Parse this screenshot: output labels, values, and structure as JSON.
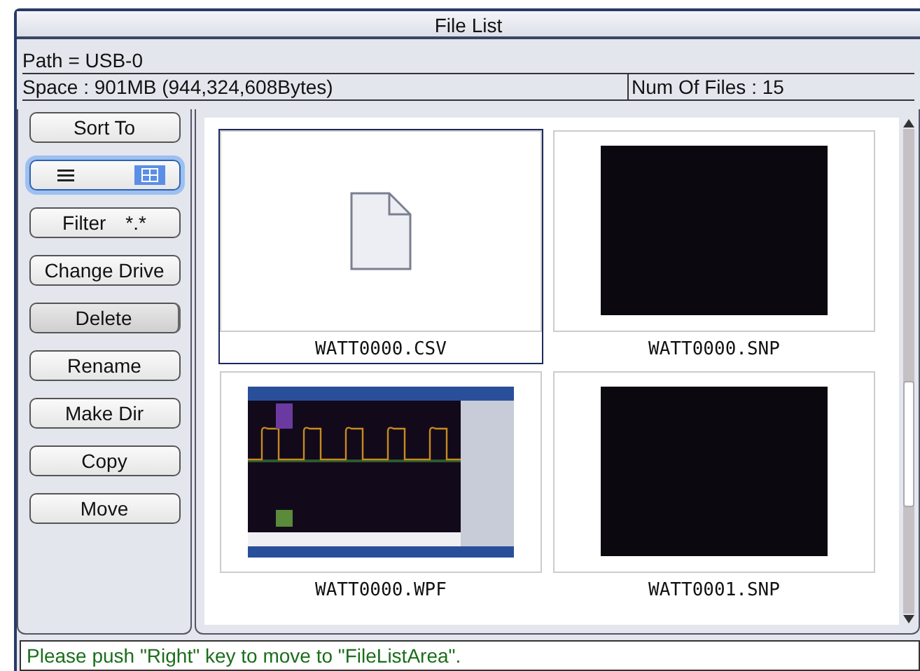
{
  "window": {
    "title": "File List"
  },
  "path": "Path = USB-0",
  "space": "Space : 901MB (944,324,608Bytes)",
  "num_files": "Num Of Files : 15",
  "sidebar": [
    {
      "kind": "button",
      "label": "Sort To",
      "pressed": false
    },
    {
      "kind": "view_toggle",
      "focused": true,
      "modes": [
        {
          "kind": "list",
          "selected": false
        },
        {
          "kind": "grid",
          "selected": true
        }
      ]
    },
    {
      "kind": "filter",
      "label": "Filter",
      "value": "*.*",
      "pressed": false
    },
    {
      "kind": "button",
      "label": "Change Drive",
      "pressed": false
    },
    {
      "kind": "button",
      "label": "Delete",
      "pressed": true
    },
    {
      "kind": "button",
      "label": "Rename",
      "pressed": false
    },
    {
      "kind": "button",
      "label": "Make Dir",
      "pressed": false
    },
    {
      "kind": "button",
      "label": "Copy",
      "pressed": false
    },
    {
      "kind": "button",
      "label": "Move",
      "pressed": false
    }
  ],
  "files": [
    {
      "name": "WATT0000.CSV",
      "kind": "document",
      "selected": true
    },
    {
      "name": "WATT0000.SNP",
      "kind": "blank",
      "selected": false
    },
    {
      "name": "WATT0000.WPF",
      "kind": "picture",
      "selected": false
    },
    {
      "name": "WATT0001.SNP",
      "kind": "blank",
      "selected": false
    }
  ],
  "status_bar": "Please push \"Right\" key to move to \"FileListArea\"."
}
